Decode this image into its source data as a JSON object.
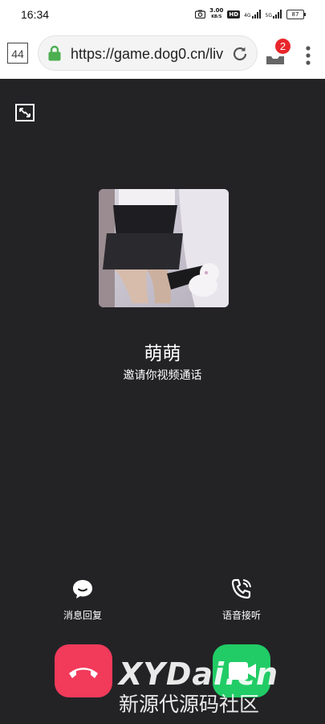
{
  "status_bar": {
    "time": "16:34",
    "speed_value": "3.00",
    "speed_unit": "KB/S",
    "hd_label": "HD",
    "signal1": "4G",
    "signal2": "5G",
    "battery": "87"
  },
  "browser": {
    "tab_count": "44",
    "url": "https://game.dog0.cn/liv",
    "download_badge": "2"
  },
  "call": {
    "caller_name": "萌萌",
    "subtitle": "邀请你视频通话",
    "message_reply_label": "消息回复",
    "voice_answer_label": "语音接听"
  },
  "watermark": {
    "brand": "XYDai.cn",
    "tagline": "新源代源码社区"
  },
  "colors": {
    "call_background": "#232326",
    "hangup": "#f23a5b",
    "accept": "#21cc66",
    "lock": "#4caf50",
    "badge": "#e8262b"
  },
  "icons": {
    "minimize": "minimize-window-icon",
    "message": "chat-bubble-icon",
    "voice": "phone-call-icon",
    "hangup": "phone-hangup-icon",
    "video": "video-camera-icon"
  }
}
